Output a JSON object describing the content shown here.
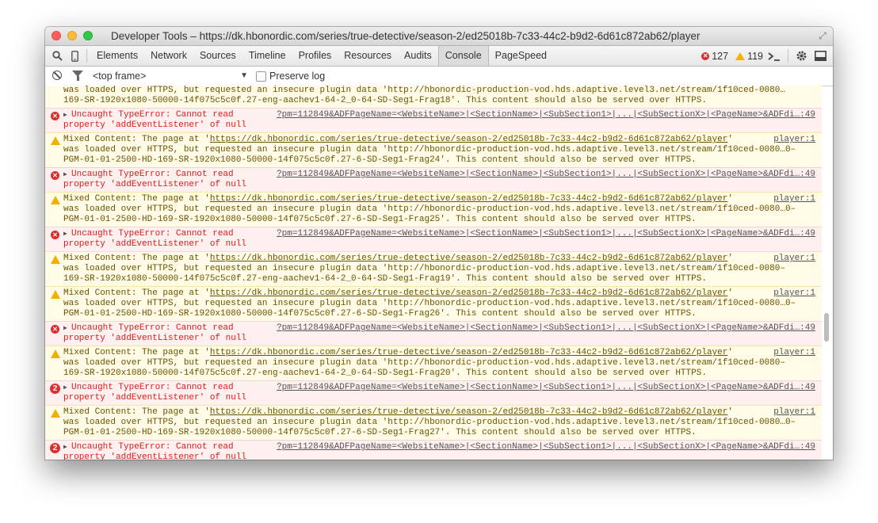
{
  "window": {
    "title": "Developer Tools – https://dk.hbonordic.com/series/true-detective/season-2/ed25018b-7c33-44c2-b9d2-6d61c872ab62/player"
  },
  "toolbar": {
    "tabs": [
      "Elements",
      "Network",
      "Sources",
      "Timeline",
      "Profiles",
      "Resources",
      "Audits",
      "Console",
      "PageSpeed"
    ],
    "active_tab": "Console",
    "error_count": "127",
    "warning_count": "119"
  },
  "filter": {
    "frame": "<top frame>",
    "preserve_log": "Preserve log"
  },
  "messages": {
    "top_partial": {
      "line1": "was loaded over HTTPS, but requested an insecure plugin data 'http://hbonordic-production-vod.hds.adaptive.level3.net/stream/1f10ced-0080…",
      "line2": "169-SR-1920x1080-50000-14f075c5c0f.27-eng-aachev1-64-2_0-64-SD-Seg1-Frag18'. This content should also be served over HTTPS."
    },
    "error": {
      "line1": "Uncaught TypeError: Cannot read",
      "line2": "property 'addEventListener' of null",
      "source": "?pm=112849&ADFPageName=<WebsiteName>|<SectionName>|<SubSection1>|...|<SubSectionX>|<PageName>&ADFdi…:49"
    },
    "warning_prefix": "Mixed Content: The page at '",
    "warning_url": "https://dk.hbonordic.com/series/true-detective/season-2/ed25018b-7c33-44c2-b9d2-6d61c872ab62/player",
    "warning_suffix": "'",
    "warning_source": "player:1",
    "w1": {
      "line2": "was loaded over HTTPS, but requested an insecure plugin data 'http://hbonordic-production-vod.hds.adaptive.level3.net/stream/1f10ced-0080…0–",
      "line3": "PGM-01-01-2500-HD-169-SR-1920x1080-50000-14f075c5c0f.27-6-SD-Seg1-Frag24'. This content should also be served over HTTPS."
    },
    "w2": {
      "line2": "was loaded over HTTPS, but requested an insecure plugin data 'http://hbonordic-production-vod.hds.adaptive.level3.net/stream/1f10ced-0080…0–",
      "line3": "PGM-01-01-2500-HD-169-SR-1920x1080-50000-14f075c5c0f.27-6-SD-Seg1-Frag25'. This content should also be served over HTTPS."
    },
    "w3": {
      "line2": "was loaded over HTTPS, but requested an insecure plugin data 'http://hbonordic-production-vod.hds.adaptive.level3.net/stream/1f10ced-0080–",
      "line3": "169-SR-1920x1080-50000-14f075c5c0f.27-eng-aachev1-64-2_0-64-SD-Seg1-Frag19'. This content should also be served over HTTPS."
    },
    "w4": {
      "line2": "was loaded over HTTPS, but requested an insecure plugin data 'http://hbonordic-production-vod.hds.adaptive.level3.net/stream/1f10ced-0080…0–",
      "line3": "PGM-01-01-2500-HD-169-SR-1920x1080-50000-14f075c5c0f.27-6-SD-Seg1-Frag26'. This content should also be served over HTTPS."
    },
    "w5": {
      "line2": "was loaded over HTTPS, but requested an insecure plugin data 'http://hbonordic-production-vod.hds.adaptive.level3.net/stream/1f10ced-0080–",
      "line3": "169-SR-1920x1080-50000-14f075c5c0f.27-eng-aachev1-64-2_0-64-SD-Seg1-Frag20'. This content should also be served over HTTPS."
    },
    "w6": {
      "line2": "was loaded over HTTPS, but requested an insecure plugin data 'http://hbonordic-production-vod.hds.adaptive.level3.net/stream/1f10ced-0080…0–",
      "line3": "PGM-01-01-2500-HD-169-SR-1920x1080-50000-14f075c5c0f.27-6-SD-Seg1-Frag27'. This content should also be served over HTTPS."
    },
    "repeat_badge": "2"
  }
}
